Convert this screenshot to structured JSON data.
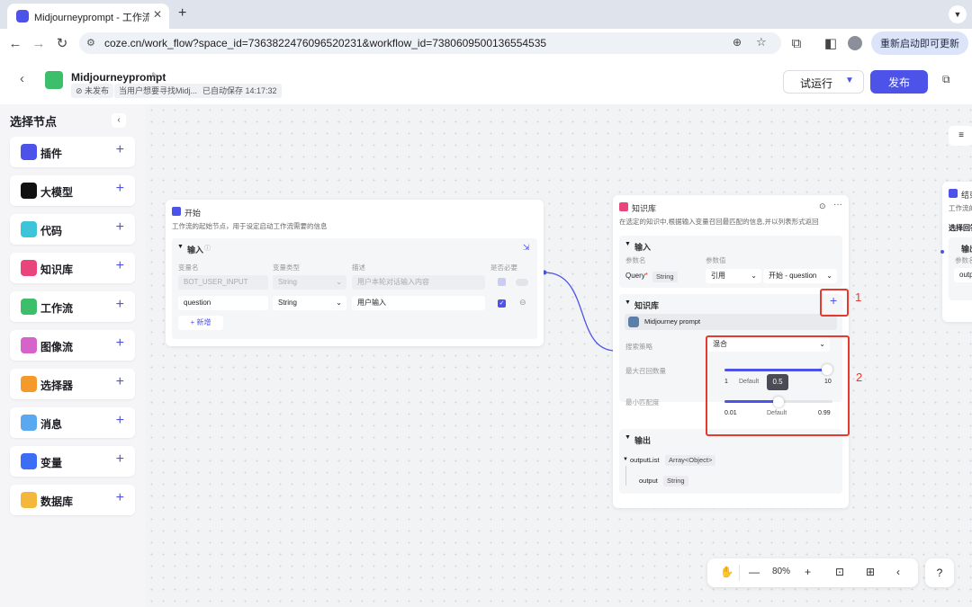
{
  "browser": {
    "tab_title": "Midjourneyprompt - 工作流 - ",
    "url": "coze.cn/work_flow?space_id=7363822476096520231&workflow_id=7380609500136554535",
    "restart_label": "重新启动即可更新"
  },
  "header": {
    "title": "Midjourneyprompt",
    "status": "未发布",
    "description": "当用户想要寻找Midj...",
    "autosave": "已自动保存 14:17:32",
    "run_label": "试运行",
    "publish_label": "发布"
  },
  "sidebar": {
    "title": "选择节点",
    "items": [
      {
        "label": "插件",
        "icon": "plugin-icon",
        "color": "#4d53e8"
      },
      {
        "label": "大模型",
        "icon": "llm-icon",
        "color": "#111111"
      },
      {
        "label": "代码",
        "icon": "code-icon",
        "color": "#3ec3d9"
      },
      {
        "label": "知识库",
        "icon": "knowledge-icon",
        "color": "#e9457c"
      },
      {
        "label": "工作流",
        "icon": "workflow-icon",
        "color": "#3dbe6a"
      },
      {
        "label": "图像流",
        "icon": "imageflow-icon",
        "color": "#d563c9"
      },
      {
        "label": "选择器",
        "icon": "selector-icon",
        "color": "#f39a2b"
      },
      {
        "label": "消息",
        "icon": "message-icon",
        "color": "#5aa8f0"
      },
      {
        "label": "变量",
        "icon": "variable-icon",
        "color": "#3b6df5"
      },
      {
        "label": "数据库",
        "icon": "database-icon",
        "color": "#f3b83b"
      }
    ]
  },
  "start_node": {
    "title": "开始",
    "desc": "工作流的起始节点，用于设定启动工作流需要的信息",
    "input_title": "输入",
    "col_name": "变量名",
    "col_type": "变量类型",
    "col_desc": "描述",
    "col_required": "是否必要",
    "rows": [
      {
        "name": "BOT_USER_INPUT",
        "type": "String",
        "desc": "用户本轮对话输入内容"
      },
      {
        "name": "question",
        "type": "String",
        "desc": "用户输入"
      }
    ],
    "add_label": "新增"
  },
  "kb_node": {
    "title": "知识库",
    "desc": "在选定的知识中,根据输入变量召回最匹配的信息,并以列表形式返回",
    "input_title": "输入",
    "param_name_label": "参数名",
    "param_value_label": "参数值",
    "query_name": "Query",
    "query_type": "String",
    "ref_label": "引用",
    "ref_value": "开始 - question",
    "kb_section": "知识库",
    "kb_item": "Midjourney prompt",
    "strategy_label": "搜索策略",
    "strategy_value": "混合",
    "max_recall_label": "最大召回数量",
    "max_min": "1",
    "max_default": "Default",
    "max_max": "10",
    "max_recall_value": 10,
    "min_match_label": "最小匹配度",
    "min_value_tooltip": "0.5",
    "min_min": "0.01",
    "min_default": "Default",
    "min_max": "0.99",
    "output_title": "输出",
    "output_list": "outputList",
    "output_list_type": "Array<Object>",
    "output_item": "output",
    "output_item_type": "String"
  },
  "end_node": {
    "title": "结束",
    "desc": "工作流的",
    "section": "选择回答",
    "sub": "输出",
    "param": "参数名",
    "val": "outp"
  },
  "annotations": {
    "one": "1",
    "two": "2",
    "color": "#e53a2e"
  },
  "toolbar": {
    "zoom": "80%"
  }
}
